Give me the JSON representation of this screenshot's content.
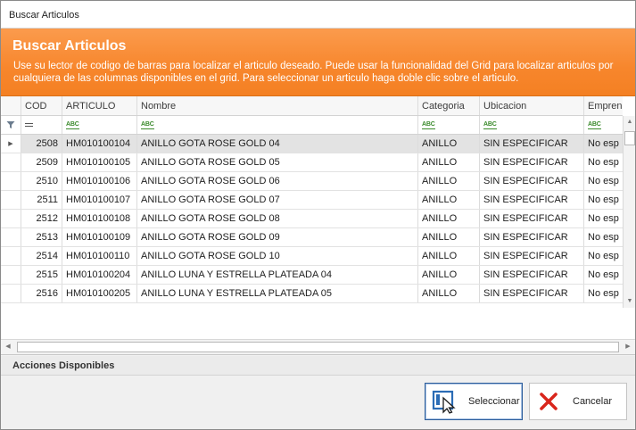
{
  "window": {
    "title": "Buscar Articulos"
  },
  "banner": {
    "title": "Buscar Articulos",
    "description": "Use su lector de codigo de barras para localizar el articulo deseado. Puede usar la funcionalidad del Grid para localizar articulos por cualquiera de las columnas disponibles en el grid. Para seleccionar un articulo haga doble clic sobre el articulo."
  },
  "grid": {
    "columns": [
      "COD",
      "ARTICULO",
      "Nombre",
      "Categoria",
      "Ubicacion",
      "Emprended"
    ],
    "filter_abc": "ABC",
    "rows": [
      {
        "cod": "2508",
        "articulo": "HM010100104",
        "nombre": "ANILLO GOTA ROSE GOLD 04",
        "categoria": "ANILLO",
        "ubicacion": "SIN ESPECIFICAR",
        "emprendedor": "No esp"
      },
      {
        "cod": "2509",
        "articulo": "HM010100105",
        "nombre": "ANILLO GOTA ROSE GOLD 05",
        "categoria": "ANILLO",
        "ubicacion": "SIN ESPECIFICAR",
        "emprendedor": "No esp"
      },
      {
        "cod": "2510",
        "articulo": "HM010100106",
        "nombre": "ANILLO GOTA ROSE GOLD 06",
        "categoria": "ANILLO",
        "ubicacion": "SIN ESPECIFICAR",
        "emprendedor": "No esp"
      },
      {
        "cod": "2511",
        "articulo": "HM010100107",
        "nombre": "ANILLO GOTA ROSE GOLD 07",
        "categoria": "ANILLO",
        "ubicacion": "SIN ESPECIFICAR",
        "emprendedor": "No esp"
      },
      {
        "cod": "2512",
        "articulo": "HM010100108",
        "nombre": "ANILLO GOTA ROSE GOLD 08",
        "categoria": "ANILLO",
        "ubicacion": "SIN ESPECIFICAR",
        "emprendedor": "No esp"
      },
      {
        "cod": "2513",
        "articulo": "HM010100109",
        "nombre": "ANILLO GOTA ROSE GOLD 09",
        "categoria": "ANILLO",
        "ubicacion": "SIN ESPECIFICAR",
        "emprendedor": "No esp"
      },
      {
        "cod": "2514",
        "articulo": "HM010100110",
        "nombre": "ANILLO GOTA ROSE GOLD 10",
        "categoria": "ANILLO",
        "ubicacion": "SIN ESPECIFICAR",
        "emprendedor": "No esp"
      },
      {
        "cod": "2515",
        "articulo": "HM010100204",
        "nombre": "ANILLO LUNA Y ESTRELLA PLATEADA 04",
        "categoria": "ANILLO",
        "ubicacion": "SIN ESPECIFICAR",
        "emprendedor": "No esp"
      },
      {
        "cod": "2516",
        "articulo": "HM010100205",
        "nombre": "ANILLO LUNA Y ESTRELLA PLATEADA 05",
        "categoria": "ANILLO",
        "ubicacion": "SIN ESPECIFICAR",
        "emprendedor": "No esp"
      }
    ]
  },
  "actions": {
    "label": "Acciones Disponibles"
  },
  "buttons": {
    "select": "Seleccionar",
    "cancel": "Cancelar"
  },
  "colors": {
    "banner": "#f7862c",
    "accept_icon": "#2b6cb5",
    "cancel_icon": "#d9261c"
  }
}
